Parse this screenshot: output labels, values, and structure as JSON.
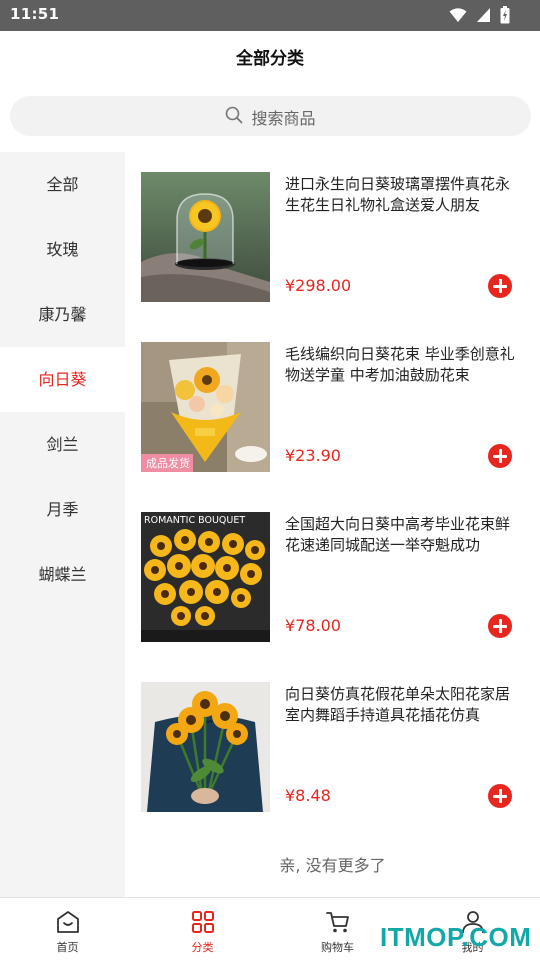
{
  "status_bar": {
    "time": "11:51",
    "icons": [
      "wifi-icon",
      "signal-icon",
      "battery-icon"
    ]
  },
  "header": {
    "title": "全部分类"
  },
  "search": {
    "placeholder": "搜索商品",
    "icon": "search-icon"
  },
  "sidebar": {
    "items": [
      {
        "label": "全部",
        "active": false
      },
      {
        "label": "玫瑰",
        "active": false
      },
      {
        "label": "康乃馨",
        "active": false
      },
      {
        "label": "向日葵",
        "active": true
      },
      {
        "label": "剑兰",
        "active": false
      },
      {
        "label": "月季",
        "active": false
      },
      {
        "label": "蝴蝶兰",
        "active": false
      }
    ]
  },
  "products": [
    {
      "title": "进口永生向日葵玻璃罩摆件真花永生花生日礼物礼盒送爱人朋友",
      "price": "¥298.00",
      "image_text": ""
    },
    {
      "title": "毛线编织向日葵花束 毕业季创意礼物送学童 中考加油鼓励花束",
      "price": "¥23.90",
      "image_text": "成品发货"
    },
    {
      "title": "全国超大向日葵中高考毕业花束鲜花速递同城配送一举夺魁成功",
      "price": "¥78.00",
      "image_text": "ROMANTIC BOUQUET"
    },
    {
      "title": "向日葵仿真花假花单朵太阳花家居室内舞蹈手持道具花插花仿真",
      "price": "¥8.48",
      "image_text": ""
    }
  ],
  "list_footer": "亲, 没有更多了",
  "tabbar": {
    "items": [
      {
        "label": "首页",
        "icon": "home-icon",
        "active": false
      },
      {
        "label": "分类",
        "icon": "category-icon",
        "active": true
      },
      {
        "label": "购物车",
        "icon": "cart-icon",
        "active": false
      },
      {
        "label": "我的",
        "icon": "user-icon",
        "active": false
      }
    ]
  },
  "watermark": "ITMOP.COM",
  "colors": {
    "accent": "#e6261f",
    "status_bar": "#5f5f5f",
    "sidebar_bg": "#f4f4f4",
    "watermark": "#13a8a8"
  }
}
